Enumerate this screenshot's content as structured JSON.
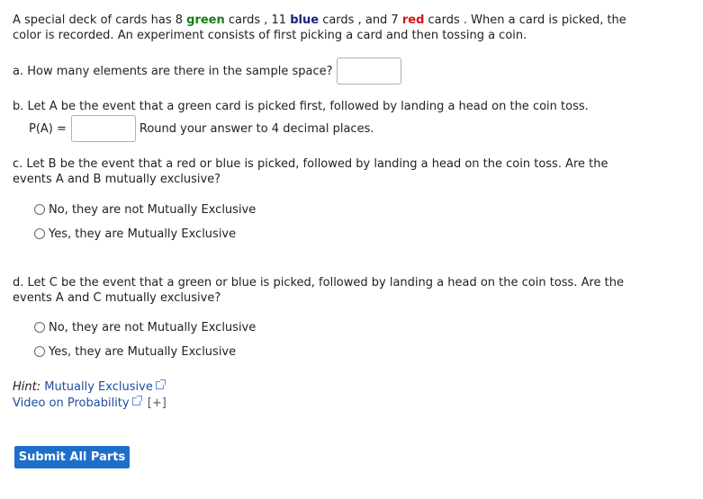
{
  "intro": {
    "part1": "A special deck of cards has 8 ",
    "green_word": "green",
    "part2": " cards , 11 ",
    "blue_word": "blue",
    "part3": " cards , and 7 ",
    "red_word": "red",
    "part4": " cards . When a card is picked, the",
    "line2": "color is recorded. An experiment consists of first picking a card and then tossing a coin."
  },
  "part_a": {
    "question": "a. How many elements are there in the sample space?",
    "answer_value": ""
  },
  "part_b": {
    "question": "b. Let A be the event that a green card is picked first, followed by landing a head on the coin toss.",
    "label": "P(A) =",
    "answer_value": "",
    "instruction": "Round your answer to 4 decimal places."
  },
  "part_c": {
    "line1": "c. Let B be the event that a red or blue is picked, followed by landing a head on the coin toss. Are the",
    "line2": "events A and B mutually exclusive?",
    "options": [
      "No, they are not Mutually Exclusive",
      "Yes, they are Mutually Exclusive"
    ]
  },
  "part_d": {
    "line1": "d. Let C be the event that a green or blue is picked, followed by landing a head on the coin toss. Are the",
    "line2": "events A and C mutually exclusive?",
    "options": [
      "No, they are not Mutually Exclusive",
      "Yes, they are Mutually Exclusive"
    ]
  },
  "hints": {
    "hint_label": "Hint:",
    "hint_link": "Mutually Exclusive",
    "video_link": "Video on Probability",
    "expand": "[+]"
  },
  "submit_label": "Submit All Parts",
  "colors": {
    "green": "#1a7a1a",
    "blue": "#1a237e",
    "red": "#d21414",
    "link": "#1d4ea0",
    "button": "#1e6fc9"
  },
  "icons": [
    "external-link-icon",
    "radio-icon"
  ]
}
